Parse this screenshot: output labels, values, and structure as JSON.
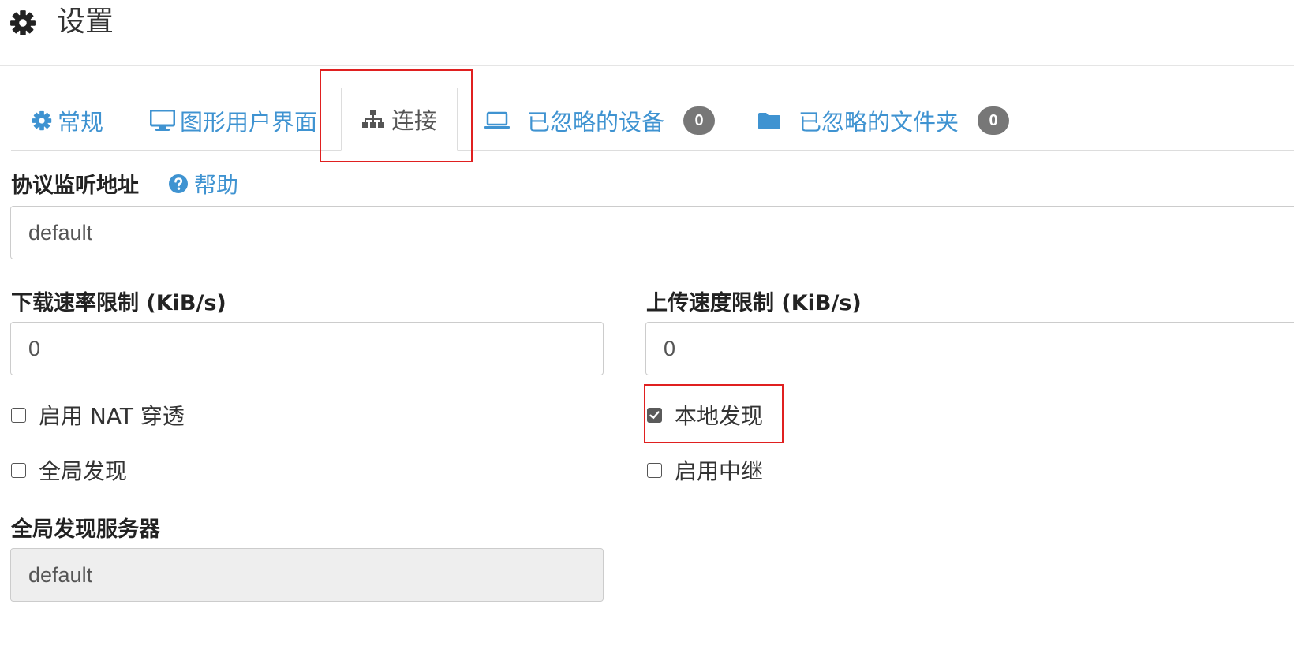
{
  "header": {
    "title": "设置",
    "icon": "gear-icon"
  },
  "tabs": [
    {
      "label": "常规",
      "icon": "gear-icon",
      "active": false
    },
    {
      "label": "图形用户界面",
      "icon": "desktop-icon",
      "active": false
    },
    {
      "label": "连接",
      "icon": "sitemap-icon",
      "active": true
    },
    {
      "label": "已忽略的设备",
      "icon": "laptop-icon",
      "badge": "0",
      "active": false
    },
    {
      "label": "已忽略的文件夹",
      "icon": "folder-icon",
      "badge": "0",
      "active": false
    }
  ],
  "listen": {
    "label": "协议监听地址",
    "help_label": "帮助",
    "value": "default"
  },
  "download": {
    "label": "下载速率限制 (KiB/s)",
    "value": "0"
  },
  "upload": {
    "label": "上传速度限制 (KiB/s)",
    "value": "0"
  },
  "checkboxes": {
    "nat": {
      "label": "启用 NAT 穿透",
      "checked": false
    },
    "local_discovery": {
      "label": "本地发现",
      "checked": true
    },
    "global_discovery": {
      "label": "全局发现",
      "checked": false
    },
    "relay": {
      "label": "启用中继",
      "checked": false
    }
  },
  "global_server": {
    "label": "全局发现服务器",
    "value": "default",
    "disabled": true
  },
  "colors": {
    "link": "#3f93d1",
    "badge": "#777777",
    "highlight": "#e02020",
    "disabled_bg": "#eeeeee"
  }
}
